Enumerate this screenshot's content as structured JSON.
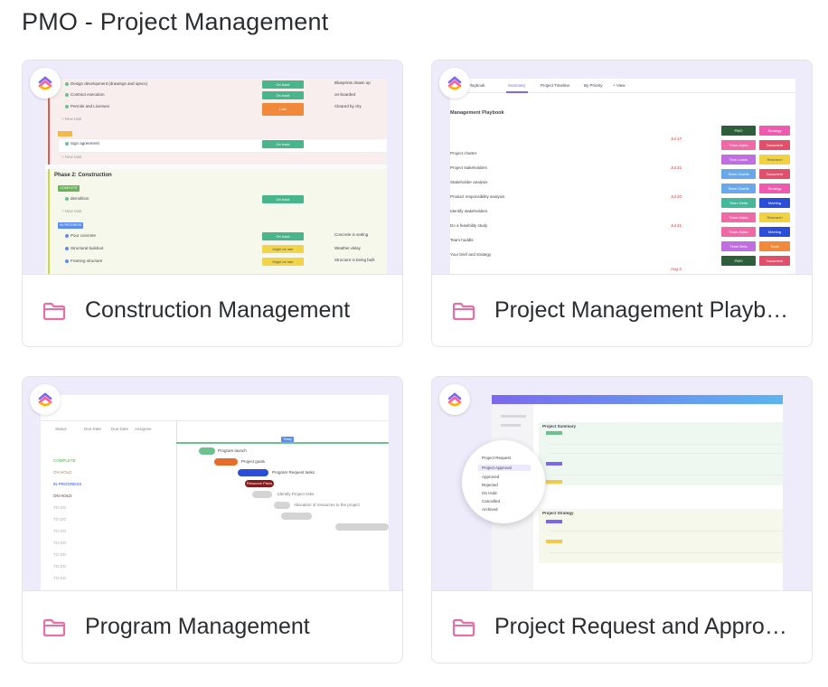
{
  "page": {
    "title": "PMO - Project Management"
  },
  "cards": [
    {
      "title": "Construction Management"
    },
    {
      "title": "Project Management Playbook"
    },
    {
      "title": "Program Management"
    },
    {
      "title": "Project Request and Approval"
    }
  ],
  "icons": {
    "logo": "clickup-logo-icon",
    "folder": "folder-icon"
  },
  "colors": {
    "folder": "#e86fa3",
    "thumb_bg": "#eeebfb"
  },
  "construction_preview": {
    "rows_top": [
      "Design development (drawings and specs)",
      "Contract execution",
      "Permits and Licenses"
    ],
    "rows_top_notes": [
      "Blueprints drawn up",
      "on-boarded",
      "Cleared by city"
    ],
    "new_task": "+ New task",
    "sign_row": "Sign agreement",
    "phase": "Phase 2: Construction",
    "phase_badge": "COMPLETE",
    "demo_row": "demolition",
    "progress_badge": "IN PROGRESS",
    "rows_bottom": [
      "Pour concrete",
      "Structural buildout",
      "Framing structure"
    ],
    "rows_bottom_notes": [
      "Concrete is setting",
      "Weather delay",
      "Structure is being built"
    ],
    "status": {
      "on_track": "On track",
      "late": "Late",
      "might_be_late": "Might be late"
    }
  },
  "playbook_preview": {
    "tabs": [
      "Playbook",
      "Summary",
      "Project Timeline",
      "By Priority",
      "+ View"
    ],
    "heading": "Management Playbook",
    "rows": [
      "Project charter",
      "Project stakeholders",
      "Stakeholder analysis",
      "Product responsibility analysis",
      "Identify stakeholders",
      "Do a feasibility study",
      "Team huddle",
      "Your brief and strategy"
    ],
    "dates": [
      "Jul 17",
      "Jul 21",
      "Jul 20",
      "Jul 21",
      "Jul 20",
      "Jul 22",
      "Jul 21",
      "Jul 21",
      "Aug 3"
    ],
    "teams": [
      "PMO",
      "Team Alpha",
      "Tech Leads",
      "Team Charlie",
      "Team Charlie",
      "Team Delta",
      "Team Alpha",
      "Team Alpha",
      "Team Beta",
      "PMO"
    ],
    "deliverables": [
      "Strategy",
      "Document",
      "Research",
      "Document",
      "Strategy",
      "Meeting",
      "Research",
      "Meeting",
      "Tools",
      "Document"
    ]
  },
  "program_preview": {
    "cols": [
      "Status",
      "Due Date",
      "Due Date",
      "Assignee"
    ],
    "statuses": [
      "COMPLETE",
      "ON HOLD",
      "IN PROGRESS",
      "ON HOLD",
      "TO DO",
      "TO DO",
      "TO DO",
      "TO DO",
      "TO DO",
      "TO DO",
      "TO DO"
    ],
    "tasks": [
      "Program launch",
      "Project goals",
      "Program Request tasks",
      "Resource Plans",
      "Identify Project risks",
      "Allocation of resources to the project",
      "Project goals",
      "Project Request tasks"
    ],
    "today": "Today"
  },
  "request_preview": {
    "menu": [
      "Project Request",
      "Project Approval",
      "Approved",
      "Rejected",
      "On Hold",
      "Cancelled",
      "Archived"
    ],
    "groups": [
      "Project Summary",
      "Project Strategy"
    ]
  }
}
